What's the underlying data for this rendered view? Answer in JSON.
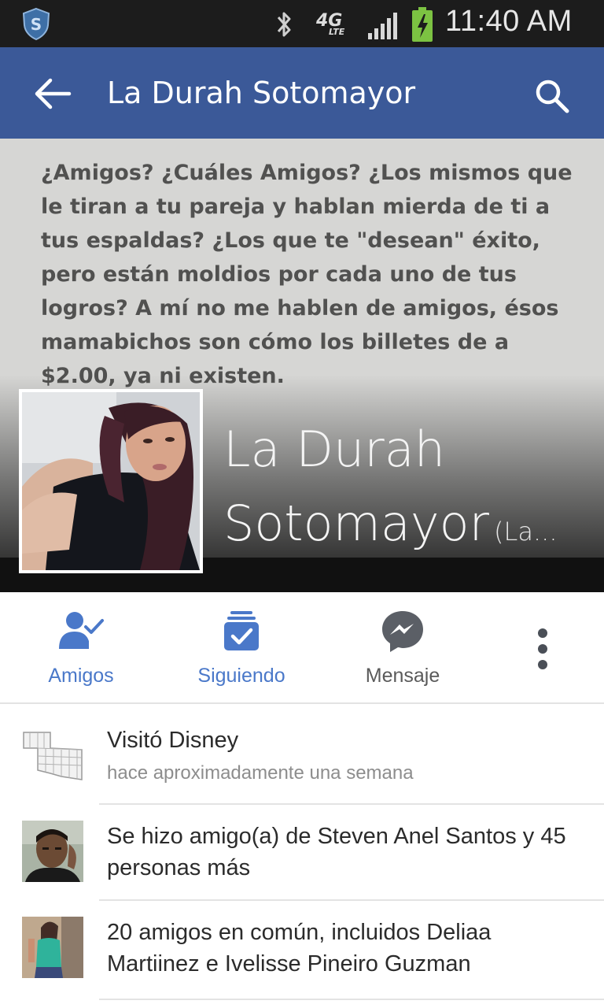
{
  "status_bar": {
    "time": "11:40 AM",
    "network_major": "4G",
    "network_minor": "LTE",
    "icons": [
      "shield-icon",
      "bluetooth-icon",
      "signal-icon",
      "battery-charging-icon"
    ]
  },
  "app_bar": {
    "title": "La Durah Sotomayor",
    "back_icon": "arrow-left-icon",
    "search_icon": "search-icon",
    "color": "#3b5998"
  },
  "profile": {
    "cover_quote": "¿Amigos? ¿Cuáles Amigos? ¿Los mismos que le tiran a tu pareja y hablan mierda de ti a tus espaldas? ¿Los que te \"desean\" éxito, pero están moldios por cada uno de tus logros? A mí no me hablen de amigos, ésos mamabichos son cómo los billetes de a $2.00, ya ni existen.",
    "name": "La Durah Sotomayor",
    "name_line_1": "La Durah",
    "name_line_2": "Sotomayor",
    "name_suffix": "(La..."
  },
  "actions": [
    {
      "label": "Amigos",
      "icon": "friends-check-icon",
      "active": true
    },
    {
      "label": "Siguiendo",
      "icon": "following-check-icon",
      "active": true
    },
    {
      "label": "Mensaje",
      "icon": "messenger-icon",
      "active": false
    },
    {
      "label": "",
      "icon": "more-vertical-icon",
      "active": false
    }
  ],
  "feed": [
    {
      "title": "Visitó Disney",
      "subtitle": "hace aproximadamente una semana",
      "thumb": "map-thumbnail"
    },
    {
      "title": "Se hizo amigo(a) de Steven Anel Santos y 45 personas más",
      "thumb": "friend-photo-thumbnail"
    },
    {
      "title": "20 amigos en común, incluidos Deliaa Martiinez e Ivelisse Pineiro Guzman",
      "thumb": "mutual-friend-photo-thumbnail"
    }
  ],
  "colors": {
    "accent_blue": "#4a78c9",
    "status_bar": "#1c1c1c",
    "battery_green": "#7cc242"
  }
}
